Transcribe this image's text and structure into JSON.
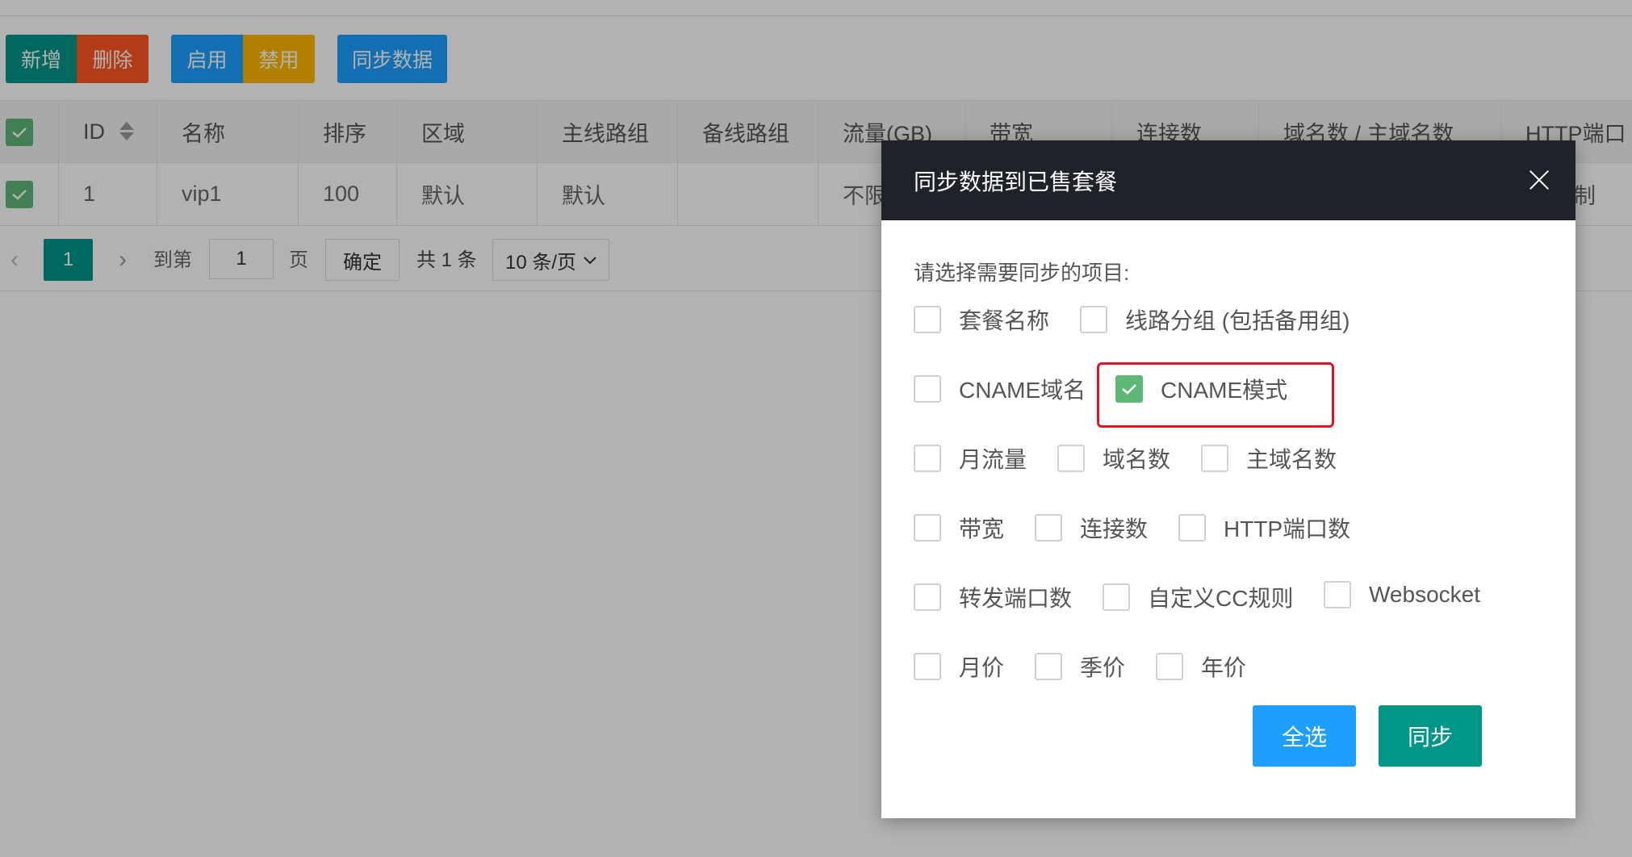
{
  "toolbar": {
    "add_label": "新增",
    "delete_label": "删除",
    "enable_label": "启用",
    "disable_label": "禁用",
    "sync_label": "同步数据"
  },
  "table": {
    "headers": [
      "ID",
      "名称",
      "排序",
      "区域",
      "主线路组",
      "备线路组",
      "流量(GB)",
      "带宽",
      "连接数",
      "域名数 / 主域名数",
      "HTTP端口"
    ],
    "row": {
      "id": "1",
      "name": "vip1",
      "sort": "100",
      "region": "默认",
      "main_group": "默认",
      "backup_group": "",
      "traffic": "不限",
      "http_port_tail": "制"
    }
  },
  "pager": {
    "current_page": "1",
    "goto_label": "到第",
    "goto_value": "1",
    "page_unit": "页",
    "confirm_label": "确定",
    "total_label": "共 1 条",
    "page_size": "10 条/页"
  },
  "modal": {
    "title": "同步数据到已售套餐",
    "prompt": "请选择需要同步的项目:",
    "options": [
      {
        "label": "套餐名称",
        "checked": false
      },
      {
        "label": "线路分组 (包括备用组)",
        "checked": false
      },
      {
        "label": "CNAME域名",
        "checked": false
      },
      {
        "label": "CNAME模式",
        "checked": true
      },
      {
        "label": "月流量",
        "checked": false
      },
      {
        "label": "域名数",
        "checked": false
      },
      {
        "label": "主域名数",
        "checked": false
      },
      {
        "label": "带宽",
        "checked": false
      },
      {
        "label": "连接数",
        "checked": false
      },
      {
        "label": "HTTP端口数",
        "checked": false
      },
      {
        "label": "转发端口数",
        "checked": false
      },
      {
        "label": "自定义CC规则",
        "checked": false
      },
      {
        "label": "Websocket",
        "checked": false
      },
      {
        "label": "月价",
        "checked": false
      },
      {
        "label": "季价",
        "checked": false
      },
      {
        "label": "年价",
        "checked": false
      }
    ],
    "select_all_label": "全选",
    "sync_label": "同步"
  },
  "colors": {
    "primary_teal": "#009688",
    "danger": "#ff5722",
    "blue": "#1e9fff",
    "warm": "#ffb800",
    "check_green": "#5fb878",
    "highlight_red": "#e1131f",
    "modal_header": "#20222a"
  }
}
